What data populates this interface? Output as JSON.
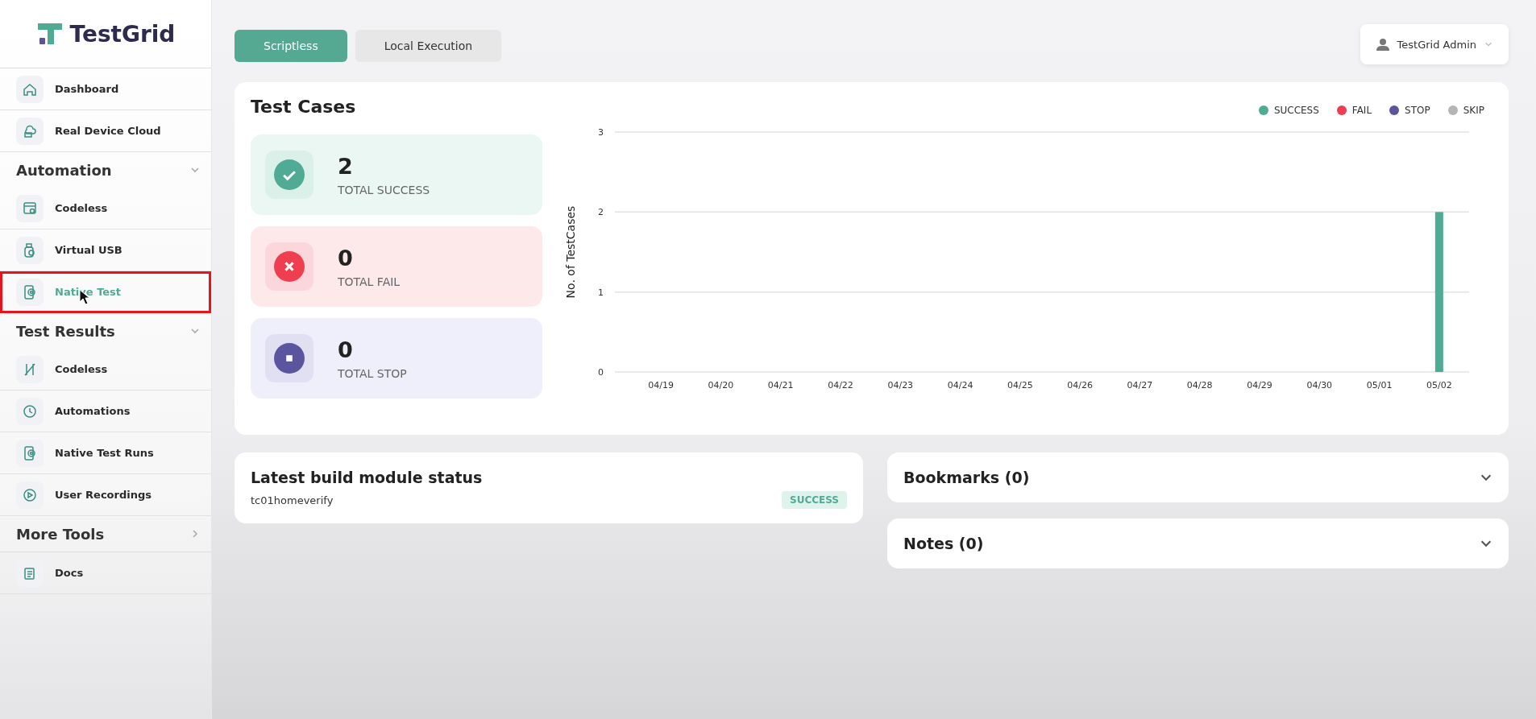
{
  "brand": {
    "name": "TestGrid"
  },
  "sidebar": {
    "items": [
      {
        "label": "Dashboard",
        "kind": "home",
        "selected": false
      },
      {
        "label": "Real Device Cloud",
        "kind": "cloud",
        "selected": false
      }
    ],
    "sections": [
      {
        "title": "Automation",
        "expanded": true,
        "items": [
          {
            "label": "Codeless",
            "kind": "codeless",
            "selected": false,
            "highlighted": false
          },
          {
            "label": "Virtual USB",
            "kind": "usb",
            "selected": false,
            "highlighted": false
          },
          {
            "label": "Native Test",
            "kind": "phone",
            "selected": true,
            "highlighted": true
          }
        ]
      },
      {
        "title": "Test Results",
        "expanded": true,
        "items": [
          {
            "label": "Codeless",
            "kind": "flask",
            "selected": false,
            "highlighted": false
          },
          {
            "label": "Automations",
            "kind": "clock",
            "selected": false,
            "highlighted": false
          },
          {
            "label": "Native Test Runs",
            "kind": "phone",
            "selected": false,
            "highlighted": false
          },
          {
            "label": "User Recordings",
            "kind": "play",
            "selected": false,
            "highlighted": false
          }
        ]
      },
      {
        "title": "More Tools",
        "expanded": false,
        "items": [
          {
            "label": "Docs",
            "kind": "docs",
            "selected": false,
            "highlighted": false
          }
        ]
      }
    ]
  },
  "tabs": [
    {
      "label": "Scriptless",
      "selected": true
    },
    {
      "label": "Local Execution",
      "selected": false
    }
  ],
  "user_menu": {
    "label": "TestGrid Admin"
  },
  "test_cases": {
    "title": "Test Cases",
    "stats": [
      {
        "kind": "success",
        "value": "2",
        "label": "TOTAL SUCCESS"
      },
      {
        "kind": "fail",
        "value": "0",
        "label": "TOTAL FAIL"
      },
      {
        "kind": "stop",
        "value": "0",
        "label": "TOTAL STOP"
      }
    ],
    "chart_data": {
      "type": "bar",
      "ylabel": "No. of TestCases",
      "categories": [
        "04/19",
        "04/20",
        "04/21",
        "04/22",
        "04/23",
        "04/24",
        "04/25",
        "04/26",
        "04/27",
        "04/28",
        "04/29",
        "04/30",
        "05/01",
        "05/02"
      ],
      "series": [
        {
          "name": "SUCCESS",
          "color": "#4fab94",
          "values": [
            0,
            0,
            0,
            0,
            0,
            0,
            0,
            0,
            0,
            0,
            0,
            0,
            0,
            2
          ]
        },
        {
          "name": "FAIL",
          "color": "#ef3e4f",
          "values": [
            0,
            0,
            0,
            0,
            0,
            0,
            0,
            0,
            0,
            0,
            0,
            0,
            0,
            0
          ]
        },
        {
          "name": "STOP",
          "color": "#5b55a0",
          "values": [
            0,
            0,
            0,
            0,
            0,
            0,
            0,
            0,
            0,
            0,
            0,
            0,
            0,
            0
          ]
        },
        {
          "name": "SKIP",
          "color": "#b5b5b5",
          "values": [
            0,
            0,
            0,
            0,
            0,
            0,
            0,
            0,
            0,
            0,
            0,
            0,
            0,
            0
          ]
        }
      ],
      "ylim": [
        0,
        3
      ],
      "yticks": [
        0,
        1,
        2,
        3
      ],
      "stacked": true
    }
  },
  "latest_build": {
    "title": "Latest build module status",
    "module": "tc01homeverify",
    "status": "SUCCESS"
  },
  "panels": [
    {
      "title": "Bookmarks (0)",
      "expanded": false
    },
    {
      "title": "Notes (0)",
      "expanded": false
    }
  ]
}
